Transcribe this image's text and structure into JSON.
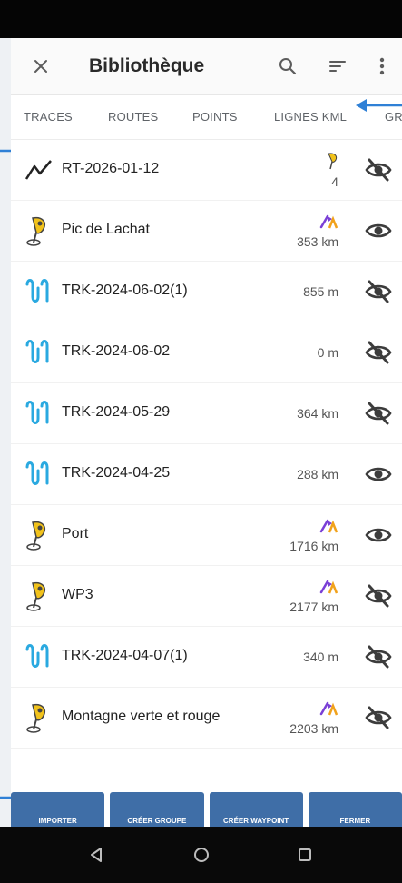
{
  "header": {
    "title": "Bibliothèque",
    "close_icon": "close-icon",
    "search_icon": "search-icon",
    "sort_icon": "sort-icon",
    "more_icon": "more-vert-icon"
  },
  "tabs": [
    "TRACES",
    "ROUTES",
    "POINTS",
    "LIGNES KML",
    "GR"
  ],
  "items": [
    {
      "name": "RT-2026-01-12",
      "icon": "route-icon",
      "value": "4",
      "meta_icon": "waypoint-small-icon",
      "visible": false
    },
    {
      "name": "Pic de Lachat",
      "icon": "waypoint-icon",
      "value": "353 km",
      "meta_icon": "direction-icon",
      "visible": true
    },
    {
      "name": "TRK-2024-06-02(1)",
      "icon": "track-icon",
      "value": "855 m",
      "meta_icon": "",
      "visible": false
    },
    {
      "name": "TRK-2024-06-02",
      "icon": "track-icon",
      "value": "0 m",
      "meta_icon": "",
      "visible": false
    },
    {
      "name": "TRK-2024-05-29",
      "icon": "track-icon",
      "value": "364 km",
      "meta_icon": "",
      "visible": false
    },
    {
      "name": "TRK-2024-04-25",
      "icon": "track-icon",
      "value": "288 km",
      "meta_icon": "",
      "visible": true
    },
    {
      "name": "Port",
      "icon": "waypoint-icon",
      "value": "1716 km",
      "meta_icon": "direction-icon",
      "visible": true
    },
    {
      "name": "WP3",
      "icon": "waypoint-icon",
      "value": "2177 km",
      "meta_icon": "direction-icon",
      "visible": false
    },
    {
      "name": "TRK-2024-04-07(1)",
      "icon": "track-icon",
      "value": "340 m",
      "meta_icon": "",
      "visible": false
    },
    {
      "name": "Montagne verte et rouge",
      "icon": "waypoint-icon",
      "value": "2203 km",
      "meta_icon": "direction-icon",
      "visible": false
    }
  ],
  "bottom_buttons": [
    "IMPORTER",
    "CRÉER GROUPE",
    "CRÉER WAYPOINT",
    "FERMER"
  ],
  "colors": {
    "accent": "#3f6ea7",
    "track": "#2aa9e0",
    "waypoint": "#f1c21b",
    "callout": "#2f80d6",
    "eye": "#3c3c3c"
  }
}
